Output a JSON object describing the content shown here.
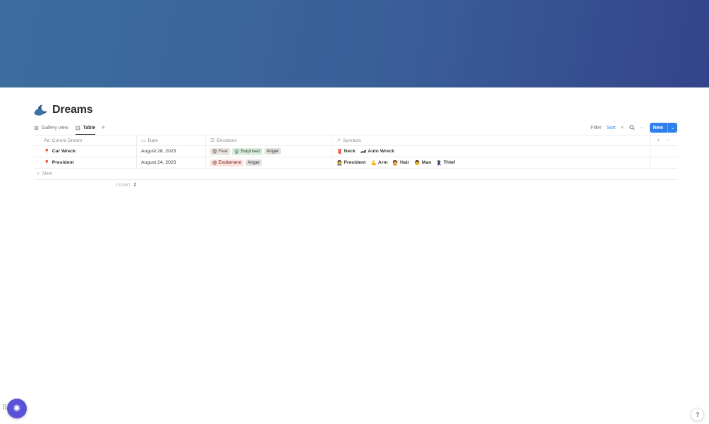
{
  "page": {
    "title": "Dreams",
    "title_icon": "moon-cloud-icon"
  },
  "views": [
    {
      "label": "Gallery view",
      "icon": "gallery-icon",
      "active": false
    },
    {
      "label": "Table",
      "icon": "table-icon",
      "active": true
    }
  ],
  "toolbar": {
    "filter": "Filter",
    "sort": "Sort",
    "new_label": "New",
    "accent": "#2f80ed"
  },
  "columns": [
    {
      "label": "Curent Dream",
      "icon": "Aa"
    },
    {
      "label": "Date",
      "icon": "calendar-icon"
    },
    {
      "label": "Emotions",
      "icon": "list-icon"
    },
    {
      "label": "Symbols",
      "icon": "relation-arrow-icon"
    }
  ],
  "rows": [
    {
      "name": "Car Wreck",
      "date": "August 28, 2023",
      "emotions": [
        "Fear",
        "Surprised",
        "Anger"
      ],
      "symbols": [
        "Neck",
        "Auto Wreck"
      ]
    },
    {
      "name": "President",
      "date": "August 24, 2023",
      "emotions": [
        "Excitement",
        "Anger"
      ],
      "symbols": [
        "President",
        "Arm",
        "Hair",
        "Man",
        "Thief"
      ]
    }
  ],
  "new_row_label": "New",
  "calc": {
    "label": "COUNT",
    "value": "2"
  },
  "help_label": "?"
}
